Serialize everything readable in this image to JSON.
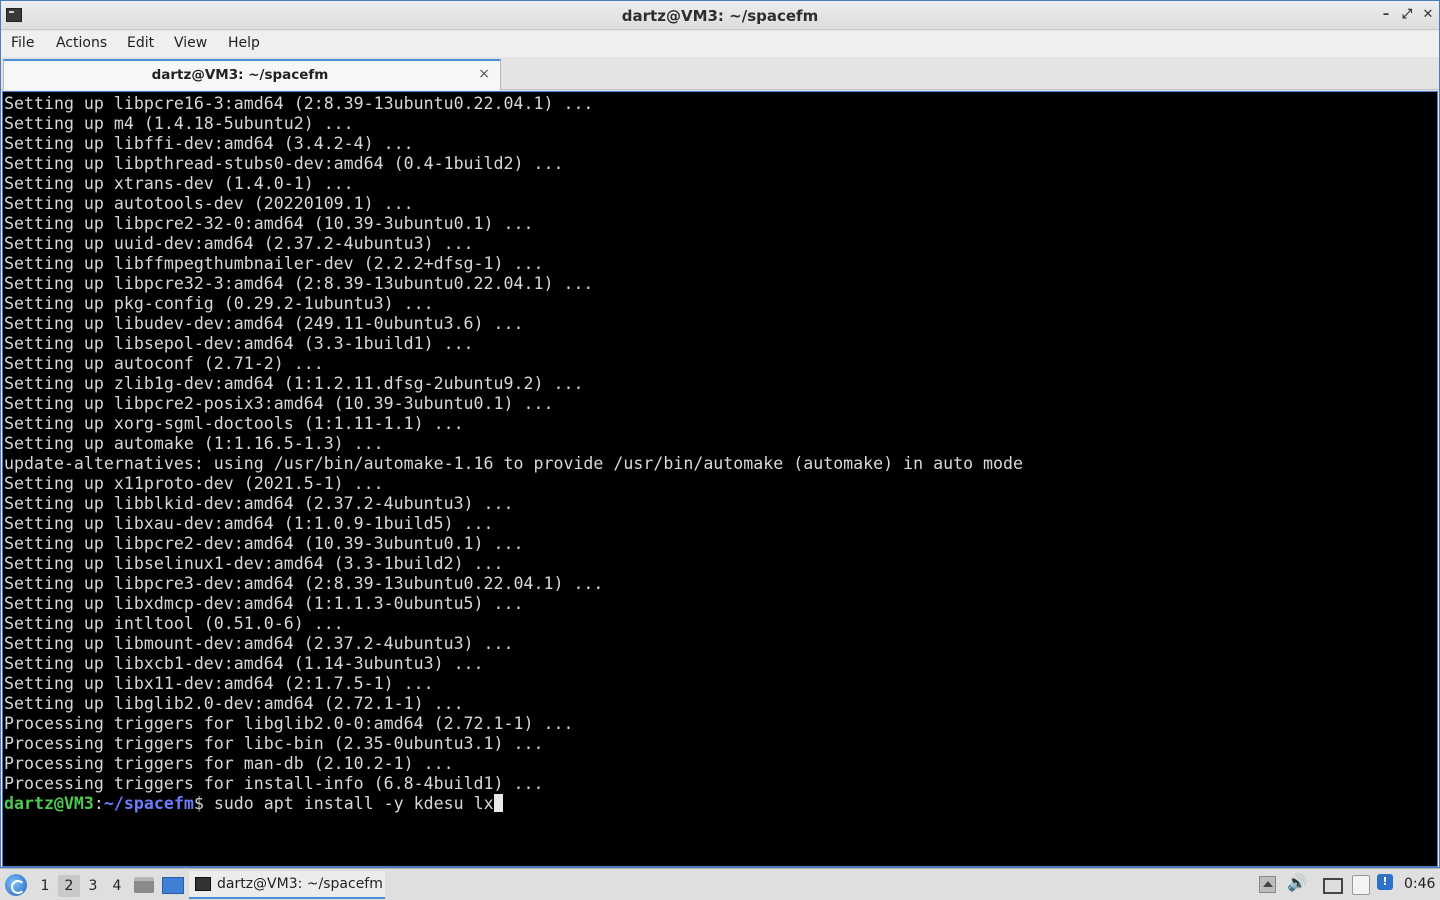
{
  "window": {
    "title": "dartz@VM3: ~/spacefm",
    "minimize_glyph": "–",
    "maximize_glyph": "⤢",
    "close_glyph": "✕"
  },
  "menu": {
    "file": "File",
    "actions": "Actions",
    "edit": "Edit",
    "view": "View",
    "help": "Help"
  },
  "tab": {
    "label": "dartz@VM3: ~/spacefm",
    "close_glyph": "×"
  },
  "terminal": {
    "lines": [
      "Setting up libpcre16-3:amd64 (2:8.39-13ubuntu0.22.04.1) ...",
      "Setting up m4 (1.4.18-5ubuntu2) ...",
      "Setting up libffi-dev:amd64 (3.4.2-4) ...",
      "Setting up libpthread-stubs0-dev:amd64 (0.4-1build2) ...",
      "Setting up xtrans-dev (1.4.0-1) ...",
      "Setting up autotools-dev (20220109.1) ...",
      "Setting up libpcre2-32-0:amd64 (10.39-3ubuntu0.1) ...",
      "Setting up uuid-dev:amd64 (2.37.2-4ubuntu3) ...",
      "Setting up libffmpegthumbnailer-dev (2.2.2+dfsg-1) ...",
      "Setting up libpcre32-3:amd64 (2:8.39-13ubuntu0.22.04.1) ...",
      "Setting up pkg-config (0.29.2-1ubuntu3) ...",
      "Setting up libudev-dev:amd64 (249.11-0ubuntu3.6) ...",
      "Setting up libsepol-dev:amd64 (3.3-1build1) ...",
      "Setting up autoconf (2.71-2) ...",
      "Setting up zlib1g-dev:amd64 (1:1.2.11.dfsg-2ubuntu9.2) ...",
      "Setting up libpcre2-posix3:amd64 (10.39-3ubuntu0.1) ...",
      "Setting up xorg-sgml-doctools (1:1.11-1.1) ...",
      "Setting up automake (1:1.16.5-1.3) ...",
      "update-alternatives: using /usr/bin/automake-1.16 to provide /usr/bin/automake (automake) in auto mode",
      "Setting up x11proto-dev (2021.5-1) ...",
      "Setting up libblkid-dev:amd64 (2.37.2-4ubuntu3) ...",
      "Setting up libxau-dev:amd64 (1:1.0.9-1build5) ...",
      "Setting up libpcre2-dev:amd64 (10.39-3ubuntu0.1) ...",
      "Setting up libselinux1-dev:amd64 (3.3-1build2) ...",
      "Setting up libpcre3-dev:amd64 (2:8.39-13ubuntu0.22.04.1) ...",
      "Setting up libxdmcp-dev:amd64 (1:1.1.3-0ubuntu5) ...",
      "Setting up intltool (0.51.0-6) ...",
      "Setting up libmount-dev:amd64 (2.37.2-4ubuntu3) ...",
      "Setting up libxcb1-dev:amd64 (1.14-3ubuntu3) ...",
      "Setting up libx11-dev:amd64 (2:1.7.5-1) ...",
      "Setting up libglib2.0-dev:amd64 (2.72.1-1) ...",
      "Processing triggers for libglib2.0-0:amd64 (2.72.1-1) ...",
      "Processing triggers for libc-bin (2.35-0ubuntu3.1) ...",
      "Processing triggers for man-db (2.10.2-1) ...",
      "Processing triggers for install-info (6.8-4build1) ..."
    ],
    "prompt_user": "dartz@VM3",
    "prompt_sep": ":",
    "prompt_path": "~/spacefm",
    "prompt_symbol": "$ ",
    "command": "sudo apt install -y kdesu lx"
  },
  "taskbar": {
    "workspaces": [
      "1",
      "2",
      "3",
      "4"
    ],
    "active_workspace": "2",
    "task_label": "dartz@VM3: ~/spacefm",
    "volume_glyph": "🔊",
    "update_glyph": "!",
    "clock": "0:46"
  }
}
